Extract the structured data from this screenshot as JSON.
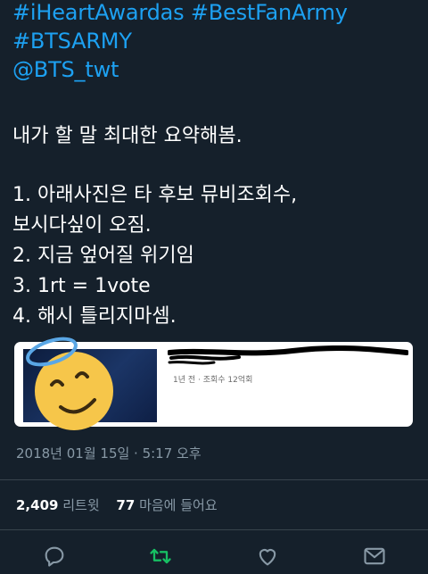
{
  "tweet": {
    "hashtag_lines": [
      "#iHeartAwardas #BestFanArmy",
      "#BTSARMY",
      "@BTS_twt"
    ],
    "body_intro": "내가 할 말 최대한 요약해봄.",
    "body_points": [
      "1. 아래사진은 타 후보 뮤비조회수,",
      "보시다싶이 오짐.",
      "2. 지금 엎어질 위기임",
      "3. 1rt = 1vote",
      "4. 해시 틀리지마셈."
    ],
    "card": {
      "meta_text": "1년 전 · 조회수 12억회"
    },
    "timestamp": "2018년 01월 15일 · 5:17 오후",
    "stats": {
      "retweets_count": "2,409",
      "retweets_label": "리트윗",
      "likes_count": "77",
      "likes_label": "마음에 들어요"
    },
    "actions": {
      "icons": [
        "reply-icon",
        "retweet-icon",
        "like-icon",
        "dm-icon"
      ],
      "retweet_color": "#17bf63",
      "icon_color": "#8899a6"
    },
    "colors": {
      "background": "#15202b",
      "link": "#1da1f2",
      "secondary_text": "#8899a6"
    }
  }
}
